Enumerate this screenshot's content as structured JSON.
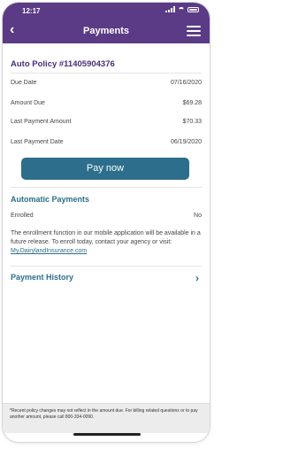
{
  "status": {
    "time": "12:17"
  },
  "nav": {
    "title": "Payments",
    "back_icon": "chevron-left-icon",
    "menu_icon": "hamburger-menu-icon"
  },
  "policy": {
    "title": "Auto Policy #11405904376",
    "rows": [
      {
        "label": "Due Date",
        "value": "07/16/2020"
      },
      {
        "label": "Amount Due",
        "value": "$69.28"
      },
      {
        "label": "Last Payment Amount",
        "value": "$70.33"
      },
      {
        "label": "Last Payment Date",
        "value": "06/19/2020"
      }
    ],
    "pay_button": "Pay now"
  },
  "automatic": {
    "title": "Automatic Payments",
    "enrolled_label": "Enrolled",
    "enrolled_value": "No",
    "message": "The enrollment function in our mobile application will be available in a future release. To enroll today, contact your agency or visit: ",
    "link": "My.DairylandInsurance.com"
  },
  "history": {
    "title": "Payment History"
  },
  "footer": {
    "note": "*Recent policy changes may not reflect in the amount due. For billing related questions or to pay another amount, please call 800-334-0090."
  },
  "colors": {
    "header": "#5b3a86",
    "accent": "#2c6e8c",
    "policy_title": "#4a2d78"
  }
}
